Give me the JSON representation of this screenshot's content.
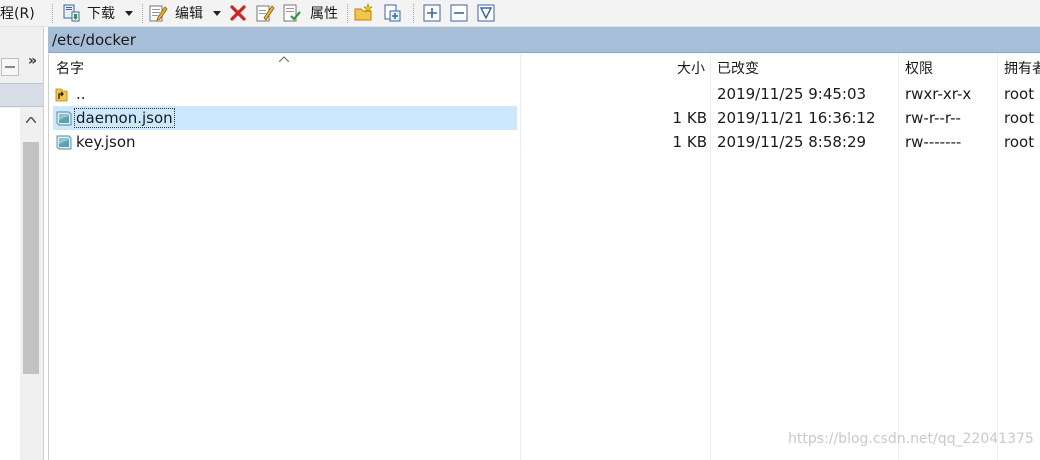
{
  "toolbar": {
    "menu_partial": "程(R)",
    "download_label": "下载",
    "edit_label": "编辑",
    "properties_label": "属性"
  },
  "path": "/etc/docker",
  "columns": {
    "name": "名字",
    "size": "大小",
    "modified": "已改变",
    "permissions": "权限",
    "owner": "拥有者"
  },
  "files": [
    {
      "name": "..",
      "size": "",
      "modified": "2019/11/25 9:45:03",
      "permissions": "rwxr-xr-x",
      "owner": "root",
      "icon": "parent-folder-icon",
      "selected": false
    },
    {
      "name": "daemon.json",
      "size": "1 KB",
      "modified": "2019/11/21 16:36:12",
      "permissions": "rw-r--r--",
      "owner": "root",
      "icon": "file-icon",
      "selected": true
    },
    {
      "name": "key.json",
      "size": "1 KB",
      "modified": "2019/11/25 8:58:29",
      "permissions": "rw-------",
      "owner": "root",
      "icon": "file-icon",
      "selected": false
    }
  ],
  "left_pane": {
    "more_label": "»"
  },
  "watermark": "https://blog.csdn.net/qq_22041375",
  "colors": {
    "path_bar": "#a7bed9",
    "selection": "#cce8ff",
    "delete_red": "#d42020"
  }
}
